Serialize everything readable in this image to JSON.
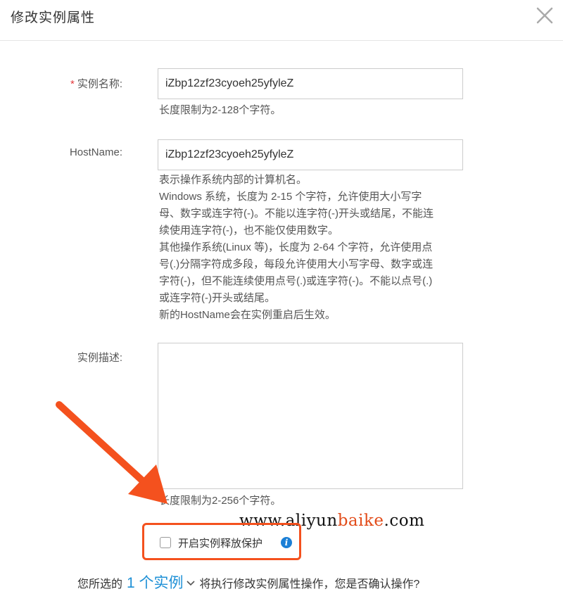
{
  "dialog": {
    "title": "修改实例属性"
  },
  "form": {
    "instance_name": {
      "label": "实例名称:",
      "required_mark": "*",
      "value": "iZbp12zf23cyoeh25yfyleZ",
      "help": "长度限制为2-128个字符。"
    },
    "hostname": {
      "label": "HostName:",
      "value": "iZbp12zf23cyoeh25yfyleZ",
      "help_lines": [
        "表示操作系统内部的计算机名。",
        "Windows 系统，长度为 2-15 个字符，允许使用大小写字",
        "母、数字或连字符(-)。不能以连字符(-)开头或结尾，不能连",
        "续使用连字符(-)，也不能仅使用数字。",
        "其他操作系统(Linux 等)，长度为 2-64 个字符，允许使用点",
        "号(.)分隔字符成多段，每段允许使用大小写字母、数字或连",
        "字符(-)，但不能连续使用点号(.)或连字符(-)。不能以点号(.)",
        "或连字符(-)开头或结尾。",
        "新的HostName会在实例重启后生效。"
      ]
    },
    "description": {
      "label": "实例描述:",
      "value": "",
      "help": "长度限制为2-256个字符。"
    },
    "release_protection": {
      "label": "开启实例释放保护",
      "checked": false,
      "info_icon": "info-icon"
    }
  },
  "watermark": {
    "prefix": "www.aliyun",
    "accent": "baike",
    "suffix": ".com"
  },
  "confirm": {
    "prefix": "您所选的",
    "instance_link": "1 个实例",
    "suffix": "将执行修改实例属性操作，您是否确认操作?"
  },
  "colors": {
    "accent_red": "#f4511e",
    "link_blue": "#1e90d6",
    "info_blue": "#1b7fd6",
    "required_red": "#e4393c"
  },
  "icons": {
    "close": "close-icon",
    "chevron": "chevron-down-icon",
    "annotation_arrow": "arrow-annotation"
  }
}
